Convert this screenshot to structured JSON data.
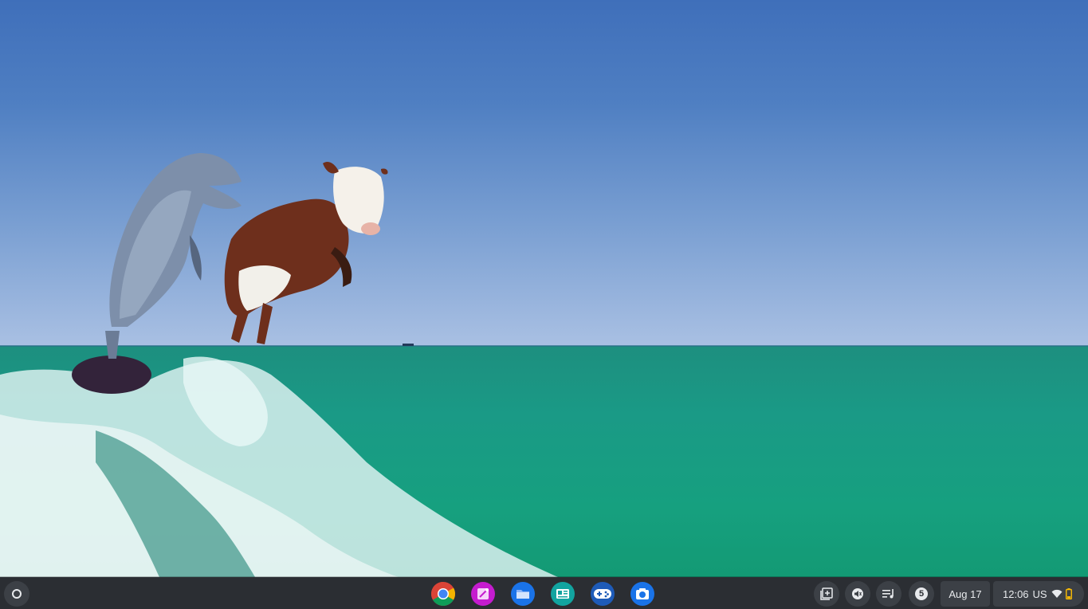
{
  "wallpaper": {
    "description_icon": "wallpaper-dolphin-cow-sea"
  },
  "shelf": {
    "launcher_icon": "launcher-circle-icon",
    "apps": [
      {
        "name": "chrome-icon"
      },
      {
        "name": "canvas-icon"
      },
      {
        "name": "files-icon"
      },
      {
        "name": "news-icon"
      },
      {
        "name": "game-controller-icon"
      },
      {
        "name": "camera-icon"
      }
    ],
    "tray": {
      "screen_capture_icon": "screen-capture-icon",
      "audio_icon": "volume-muted-icon",
      "media_icon": "media-queue-icon",
      "notification_count": "5",
      "date": "Aug 17",
      "time": "12:06",
      "ime": "US",
      "wifi_icon": "wifi-icon",
      "battery_icon": "battery-icon"
    }
  },
  "colors": {
    "shelf_bg": "#2b2e33",
    "tray_bg": "#3c4046",
    "battery_accent": "#fbbc04"
  }
}
